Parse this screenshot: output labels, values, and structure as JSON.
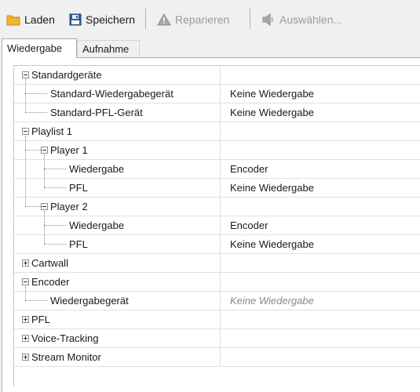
{
  "toolbar": {
    "load_label": "Laden",
    "save_label": "Speichern",
    "repair_label": "Reparieren",
    "select_label": "Auswählen..."
  },
  "tabs": [
    {
      "label": "Wiedergabe",
      "active": true
    },
    {
      "label": "Aufnahme",
      "active": false
    }
  ],
  "tree": {
    "rows": [
      {
        "label": "Standardgeräte",
        "value": "",
        "level": 0,
        "toggle": "expanded"
      },
      {
        "label": "Standard-Wiedergabegerät",
        "value": "Keine Wiedergabe",
        "level": 1,
        "toggle": "none"
      },
      {
        "label": "Standard-PFL-Gerät",
        "value": "Keine Wiedergabe",
        "level": 1,
        "toggle": "none"
      },
      {
        "label": "Playlist 1",
        "value": "",
        "level": 0,
        "toggle": "expanded"
      },
      {
        "label": "Player 1",
        "value": "",
        "level": 1,
        "toggle": "expanded"
      },
      {
        "label": "Wiedergabe",
        "value": "Encoder",
        "level": 2,
        "toggle": "none"
      },
      {
        "label": "PFL",
        "value": "Keine Wiedergabe",
        "level": 2,
        "toggle": "none"
      },
      {
        "label": "Player 2",
        "value": "",
        "level": 1,
        "toggle": "expanded"
      },
      {
        "label": "Wiedergabe",
        "value": "Encoder",
        "level": 2,
        "toggle": "none"
      },
      {
        "label": "PFL",
        "value": "Keine Wiedergabe",
        "level": 2,
        "toggle": "none"
      },
      {
        "label": "Cartwall",
        "value": "",
        "level": 0,
        "toggle": "collapsed"
      },
      {
        "label": "Encoder",
        "value": "",
        "level": 0,
        "toggle": "expanded"
      },
      {
        "label": "Wiedergabegerät",
        "value": "Keine Wiedergabe",
        "level": 1,
        "toggle": "none",
        "muted": true
      },
      {
        "label": "PFL",
        "value": "",
        "level": 0,
        "toggle": "collapsed"
      },
      {
        "label": "Voice-Tracking",
        "value": "",
        "level": 0,
        "toggle": "collapsed"
      },
      {
        "label": "Stream Monitor",
        "value": "",
        "level": 0,
        "toggle": "collapsed"
      }
    ]
  },
  "colors": {
    "folder": "#f2b632",
    "disk": "#2f5d9c",
    "warning": "#9a9a9a"
  },
  "icons": [
    "folder-icon",
    "floppy-disk-icon",
    "warning-icon",
    "speaker-icon"
  ]
}
